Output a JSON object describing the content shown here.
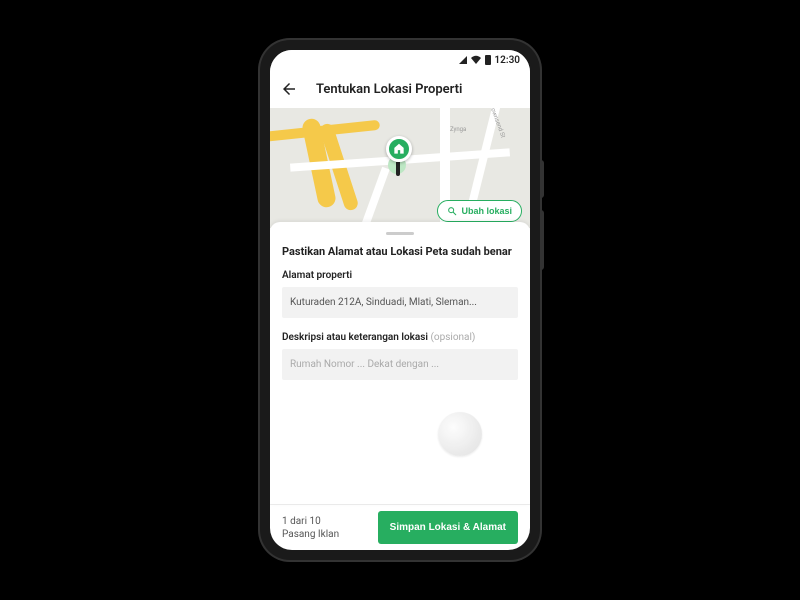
{
  "status": {
    "time": "12:30"
  },
  "header": {
    "title": "Tentukan Lokasi Properti"
  },
  "map": {
    "change_location_label": "Ubah lokasi",
    "poi_zynga": "Zynga",
    "street_townsend": "Townsend St"
  },
  "sheet": {
    "title": "Pastikan Alamat atau Lokasi Peta sudah benar",
    "address_label": "Alamat properti",
    "address_value": "Kuturaden 212A, Sinduadi, Mlati, Sleman...",
    "desc_label": "Deskripsi atau keterangan lokasi",
    "desc_optional": "(opsional)",
    "desc_placeholder": "Rumah Nomor ... Dekat dengan ..."
  },
  "footer": {
    "progress_line1": "1 dari 10",
    "progress_line2": "Pasang Iklan",
    "save_label": "Simpan Lokasi & Alamat"
  }
}
